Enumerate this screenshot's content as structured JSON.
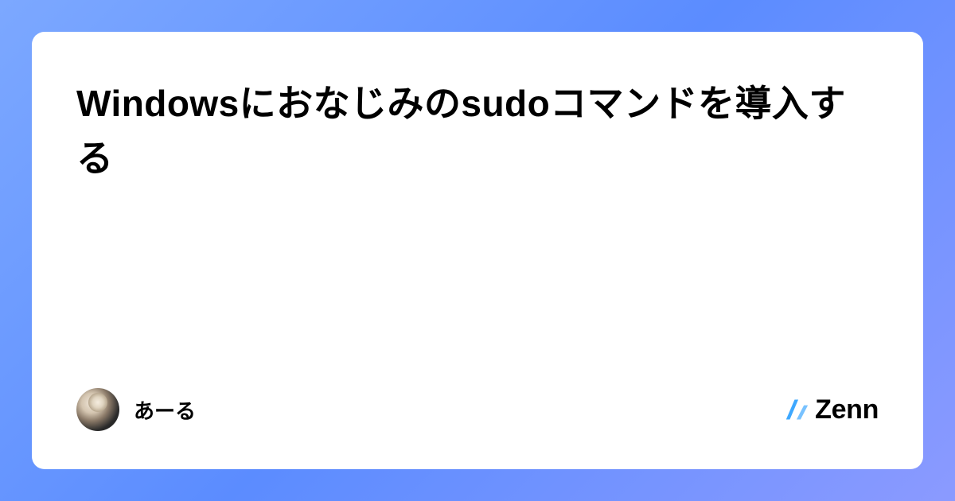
{
  "article": {
    "title": "Windowsにおなじみのsudoコマンドを導入する"
  },
  "author": {
    "name": "あーる"
  },
  "brand": {
    "name": "Zenn",
    "accent_color": "#3ea8ff"
  }
}
